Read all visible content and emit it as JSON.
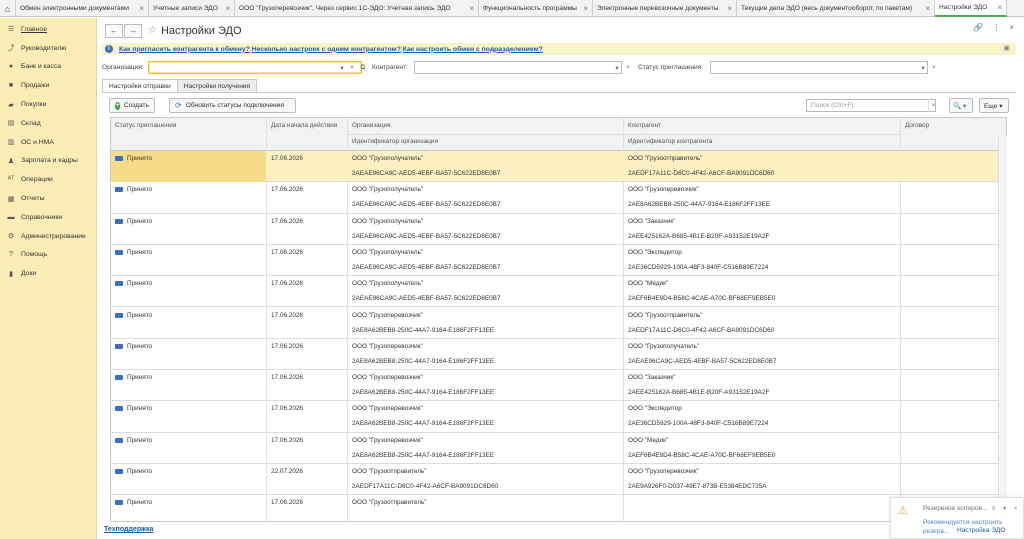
{
  "tabs": [
    {
      "label": "Обмен электронными документами",
      "active": false
    },
    {
      "label": "Учетные записи ЭДО",
      "active": false
    },
    {
      "label": "ООО \"Грузоперевозчик\", Через сервис 1С-ЭДО: Учетная запись ЭДО",
      "active": false
    },
    {
      "label": "Функциональность программы",
      "active": false
    },
    {
      "label": "Электронные перевозочные документы",
      "active": false
    },
    {
      "label": "Текущие дела ЭДО (весь документооборот, по пакетам)",
      "active": false
    },
    {
      "label": "Настройки ЭДО",
      "active": true
    }
  ],
  "sidebar": {
    "items": [
      {
        "label": "Главное",
        "icon": "menu-icon"
      },
      {
        "label": "Руководителю",
        "icon": "chart-icon"
      },
      {
        "label": "Банк и касса",
        "icon": "bank-icon"
      },
      {
        "label": "Продажи",
        "icon": "cart-icon"
      },
      {
        "label": "Покупки",
        "icon": "basket-icon"
      },
      {
        "label": "Склад",
        "icon": "warehouse-icon"
      },
      {
        "label": "ОС и НМА",
        "icon": "assets-icon"
      },
      {
        "label": "Зарплата и кадры",
        "icon": "people-icon"
      },
      {
        "label": "Операции",
        "icon": "operations-icon"
      },
      {
        "label": "Отчеты",
        "icon": "reports-icon"
      },
      {
        "label": "Справочники",
        "icon": "book-icon"
      },
      {
        "label": "Администрирование",
        "icon": "gear-icon"
      },
      {
        "label": "Помощь",
        "icon": "help-icon"
      },
      {
        "label": "Доки",
        "icon": "docs-icon"
      }
    ]
  },
  "header": {
    "title": "Настройки ЭДО",
    "back": "←",
    "forward": "→",
    "star": "☆",
    "link_glyph": "🔗",
    "more_glyph": "⋮",
    "close_glyph": "×"
  },
  "infobar": {
    "icon": "i",
    "link1": "Как пригласить контрагента к обмену?",
    "sep1": ";",
    "link2": "Несколько настроек с одним контрагентом?",
    "sep2": ";",
    "link3": "Как настроить обмен с подразделением?",
    "close": "▣"
  },
  "filters": {
    "organization_label": "Организация:",
    "counterparty_label": "Контрагент:",
    "status_label": "Статус приглашения:",
    "dropdown_glyph": "▾",
    "clear_glyph": "×",
    "open_glyph": "⧉"
  },
  "subtabs": [
    "Настройки отправки",
    "Настройки получения"
  ],
  "toolbar": {
    "create": "Создать",
    "refresh": "Обновить статусы подключения",
    "search_placeholder": "Поиск (Ctrl+F)",
    "search_clear": "×",
    "search_btn": "🔍 ▾",
    "more": "Еще ▾"
  },
  "table": {
    "headers": {
      "status": "Статус приглашения",
      "date": "Дата начала действия",
      "organization": "Организация",
      "counterparty": "Контрагент",
      "contract": "Договор",
      "org_id": "Идентификатор организации",
      "counterparty_id": "Идентификатор контрагента"
    },
    "rows": [
      {
        "status": "Принято",
        "date": "17.06.2026",
        "org": "ООО \"Грузополучатель\"",
        "org_id": "2AEAE96CA9C-AED5-4EBF-BA57-5C622ED8E0B7",
        "cp": "ООО \"Грузоотправитель\"",
        "cp_id": "2AEDF17A11C-D6C0-4F42-A6CF-BA9091DC6D60",
        "selected": true
      },
      {
        "status": "Принято",
        "date": "17.06.2026",
        "org": "ООО \"Грузополучатель\"",
        "org_id": "2AEAE96CA9C-AED5-4EBF-BA57-5C622ED8E0B7",
        "cp": "ООО \"Грузоперевозчик\"",
        "cp_id": "2AE8A62BEB8-250C-44A7-9164-E186F2FF13EE",
        "selected": false
      },
      {
        "status": "Принято",
        "date": "17.06.2026",
        "org": "ООО \"Грузополучатель\"",
        "org_id": "2AEAE96CA9C-AED5-4EBF-BA57-5C622ED8E0B7",
        "cp": "ООО \"Заказчик\"",
        "cp_id": "2AEE425162A-B685-4B1E-B20F-A93152E19A2F",
        "selected": false
      },
      {
        "status": "Принято",
        "date": "17.06.2026",
        "org": "ООО \"Грузополучатель\"",
        "org_id": "2AEAE96CA9C-AED5-4EBF-BA57-5C622ED8E0B7",
        "cp": "ООО \"Экспедитор",
        "cp_id": "2AE36CD5929-100A-48F3-840F-C516B89E7224",
        "selected": false
      },
      {
        "status": "Принято",
        "date": "17.06.2026",
        "org": "ООО \"Грузополучатель\"",
        "org_id": "2AEAE96CA9C-AED5-4EBF-BA57-5C622ED8E0B7",
        "cp": "ООО \"Медик\"",
        "cp_id": "2AEF6B4E9D4-B58C-4CAE-A70C-BF68EF9EB5E0",
        "selected": false
      },
      {
        "status": "Принято",
        "date": "17.06.2026",
        "org": "ООО \"Грузоперевозчик\"",
        "org_id": "2AE8A62BEB8-250C-44A7-9164-E186F2FF13EE",
        "cp": "ООО \"Грузоотправитель\"",
        "cp_id": "2AEDF17A11C-D6C0-4F42-A6CF-BA9091DC6D60",
        "selected": false
      },
      {
        "status": "Принято",
        "date": "17.06.2026",
        "org": "ООО \"Грузоперевозчик\"",
        "org_id": "2AE8A62BEB8-250C-44A7-9164-E186F2FF13EE",
        "cp": "ООО \"Грузополучатель\"",
        "cp_id": "2AEAE96CA9C-AED5-4EBF-BA57-5C622ED8E0B7",
        "selected": false
      },
      {
        "status": "Принято",
        "date": "17.06.2026",
        "org": "ООО \"Грузоперевозчик\"",
        "org_id": "2AE8A62BEB8-250C-44A7-9164-E186F2FF13EE",
        "cp": "ООО \"Заказчик\"",
        "cp_id": "2AEE425162A-B685-4B1E-B20F-A93152E19A2F",
        "selected": false
      },
      {
        "status": "Принято",
        "date": "17.06.2026",
        "org": "ООО \"Грузоперевозчик\"",
        "org_id": "2AE8A62BEB8-250C-44A7-9164-E186F2FF13EE",
        "cp": "ООО \"Экспедитор",
        "cp_id": "2AE36CD5929-100A-48F3-840F-C516B89E7224",
        "selected": false
      },
      {
        "status": "Принято",
        "date": "17.06.2026",
        "org": "ООО \"Грузоперевозчик\"",
        "org_id": "2AE8A62BEB8-250C-44A7-9164-E186F2FF13EE",
        "cp": "ООО \"Медик\"",
        "cp_id": "2AEF6B4E9D4-B58C-4CAE-A70C-BF68EF9EB5E0",
        "selected": false
      },
      {
        "status": "Принято",
        "date": "22.07.2026",
        "org": "ООО \"Грузоотправитель\"",
        "org_id": "2AEDF17A11C-D6C0-4F42-A6CF-BA9091DC6D60",
        "cp": "ООО \"Грузоперевозчик\"",
        "cp_id": "2AE9A926F0-D037-49E7-873B-E5384EDC735A",
        "selected": false
      },
      {
        "status": "Принято",
        "date": "17.06.2026",
        "org": "ООО \"Грузоотправитель\"",
        "org_id": "",
        "cp": "",
        "cp_id": "",
        "selected": false
      }
    ]
  },
  "footer": {
    "support_link": "Техподдержка"
  },
  "notification": {
    "title": "Резервное копиров...",
    "text": "Рекомендуется настроить резерв...",
    "under": "Настройка ЭДО"
  },
  "colors": {
    "sidebar_bg": "#fbedb5",
    "selected_row": "#fdf1c4",
    "link": "#1a5aa6",
    "accent_green": "#3aa142"
  }
}
